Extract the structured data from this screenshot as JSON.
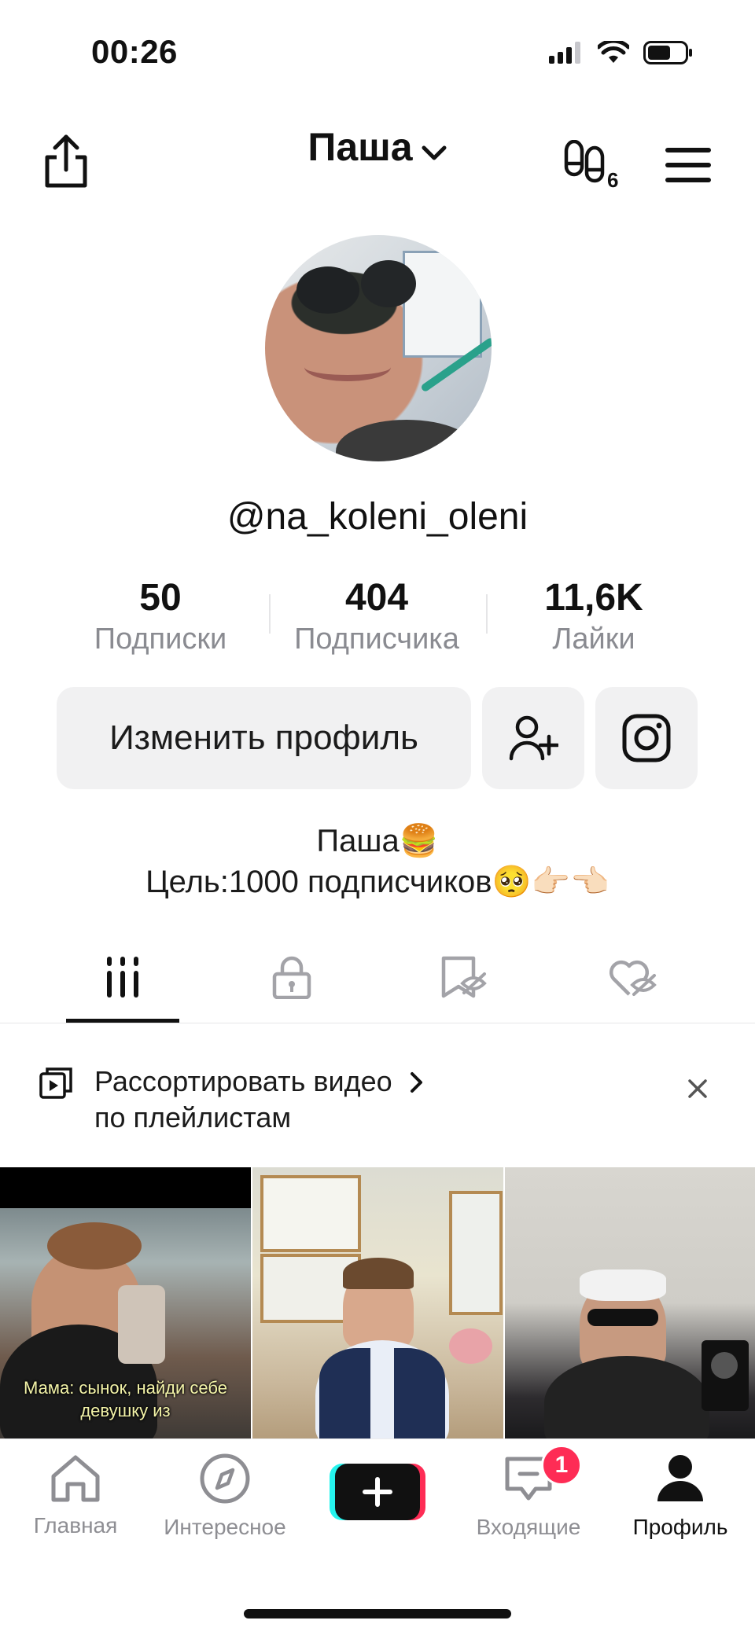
{
  "status_bar": {
    "time": "00:26",
    "icons": [
      "signal-icon",
      "wifi-icon",
      "battery-icon"
    ]
  },
  "header": {
    "title": "Паша",
    "icons": [
      "share-icon",
      "footprints-icon",
      "menu-icon"
    ]
  },
  "profile": {
    "username": "@na_koleni_oleni",
    "stats": [
      {
        "value": "50",
        "label": "Подписки"
      },
      {
        "value": "404",
        "label": "Подписчика"
      },
      {
        "value": "11,6K",
        "label": "Лайки"
      }
    ],
    "edit_button": "Изменить профиль",
    "bio_line1": "Паша🍔",
    "bio_line2": "Цель:1000 подписчиков🥺👉🏻👈🏻"
  },
  "tabs": [
    "videos-grid-icon",
    "lock-icon",
    "saved-hidden-icon",
    "liked-hidden-icon"
  ],
  "playlist_banner": {
    "line1": "Рассортировать видео",
    "line2": "по плейлистам"
  },
  "videos": [
    {
      "caption": "Мама: сынок, найди себе девушку из"
    },
    {
      "caption": ""
    },
    {
      "caption": ""
    }
  ],
  "bottom_nav": {
    "items": [
      {
        "label": "Главная",
        "icon": "home-icon"
      },
      {
        "label": "Интересное",
        "icon": "compass-icon"
      },
      {
        "label": "",
        "icon": "plus-icon"
      },
      {
        "label": "Входящие",
        "icon": "inbox-icon"
      },
      {
        "label": "Профиль",
        "icon": "profile-icon"
      }
    ],
    "inbox_badge": "1"
  },
  "colors": {
    "accent_red": "#fe2c55",
    "accent_cyan": "#25f4ee",
    "muted_gray": "#8a8b91",
    "button_bg": "#f1f1f2"
  }
}
